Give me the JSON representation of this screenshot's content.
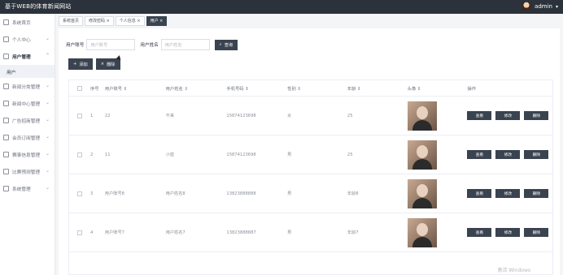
{
  "app": {
    "title": "基于WEB的体育新闻网站",
    "user_name": "admin"
  },
  "sidebar": {
    "items": [
      {
        "label": "系统首页",
        "icon": "home-icon",
        "active": false
      },
      {
        "label": "个人中心",
        "icon": "person-icon",
        "active": false
      },
      {
        "label": "用户管理",
        "icon": "grid-icon",
        "active": true
      },
      {
        "label": "新闻分类管理",
        "icon": "doc-icon",
        "active": false
      },
      {
        "label": "新闻中心管理",
        "icon": "doc-icon",
        "active": false
      },
      {
        "label": "广告招商管理",
        "icon": "doc-icon",
        "active": false
      },
      {
        "label": "会员订阅管理",
        "icon": "doc-icon",
        "active": false
      },
      {
        "label": "赛事信息管理",
        "icon": "chart-icon",
        "active": false
      },
      {
        "label": "比赛预测管理",
        "icon": "chart-icon",
        "active": false
      },
      {
        "label": "系统管理",
        "icon": "grid-icon",
        "active": false
      }
    ],
    "sub_item": "用户"
  },
  "tabs": [
    {
      "label": "系统首页"
    },
    {
      "label": "修改密码 ×"
    },
    {
      "label": "个人信息 ×"
    },
    {
      "label": "用户 ×",
      "active": true
    }
  ],
  "search": {
    "account_label": "用户账号",
    "account_placeholder": "用户账号",
    "name_label": "用户姓名",
    "name_placeholder": "用户姓名",
    "search_button": "查询"
  },
  "actions": {
    "add": "添加",
    "delete": "删除"
  },
  "table": {
    "headers": [
      "序号",
      "用户账号 ⇕",
      "用户姓名 ⇕",
      "手机号码 ⇕",
      "性别 ⇕",
      "年龄 ⇕",
      "头像 ⇕",
      "操作"
    ],
    "rows": [
      {
        "index": "1",
        "account": "22",
        "name": "不来",
        "phone": "15874123698",
        "gender": "女",
        "age": "25"
      },
      {
        "index": "2",
        "account": "11",
        "name": "小蓝",
        "phone": "15874123698",
        "gender": "男",
        "age": "25"
      },
      {
        "index": "3",
        "account": "用户账号8",
        "name": "用户姓名8",
        "phone": "13823888888",
        "gender": "男",
        "age": "年龄8"
      },
      {
        "index": "4",
        "account": "用户账号7",
        "name": "用户姓名7",
        "phone": "13823888887",
        "gender": "男",
        "age": "年龄7"
      }
    ],
    "ops": [
      "查看",
      "修改",
      "删除"
    ]
  },
  "watermark": "激活 Windows"
}
